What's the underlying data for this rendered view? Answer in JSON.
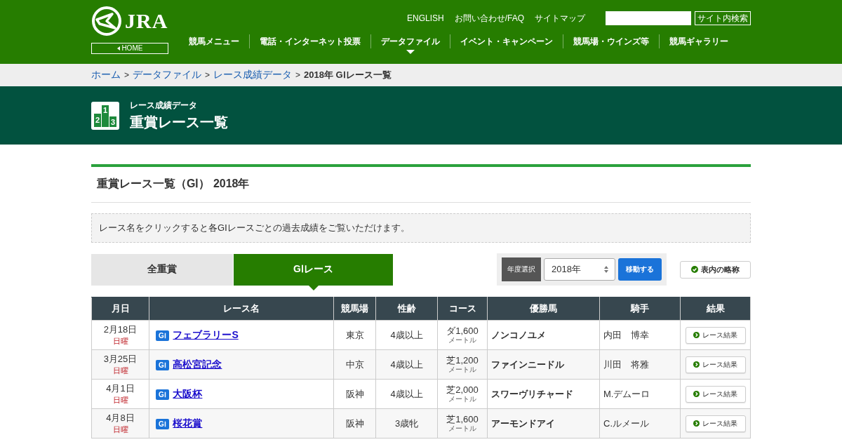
{
  "header": {
    "logo_text": "JRA",
    "home_button": "HOME",
    "top_links": [
      "ENGLISH",
      "お問い合わせ/FAQ",
      "サイトマップ"
    ],
    "search": {
      "button": "サイト内検索"
    },
    "nav": [
      {
        "label": "競馬メニュー",
        "selected": false
      },
      {
        "label": "電話・インターネット投票",
        "selected": false
      },
      {
        "label": "データファイル",
        "selected": true
      },
      {
        "label": "イベント・キャンペーン",
        "selected": false
      },
      {
        "label": "競馬場・ウインズ等",
        "selected": false
      },
      {
        "label": "競馬ギャラリー",
        "selected": false
      }
    ]
  },
  "breadcrumb": {
    "links": [
      {
        "label": "ホーム",
        "separator": ">"
      },
      {
        "label": "データファイル",
        "separator": ">"
      },
      {
        "label": "レース成績データ",
        "separator": ">"
      }
    ],
    "current": "2018年 GⅠレース一覧"
  },
  "page_title": {
    "podium_numbers": [
      "2",
      "1",
      "3"
    ],
    "subtitle": "レース成績データ",
    "title": "重賞レース一覧"
  },
  "section_heading": "重賞レース一覧（GⅠ） 2018年",
  "note": "レース名をクリックすると各GⅠレースごとの過去成績をご覧いただけます。",
  "tabs": [
    {
      "label": "全重賞",
      "selected": false
    },
    {
      "label": "GⅠレース",
      "selected": true
    }
  ],
  "year_select": {
    "label": "年度選択",
    "value": "2018年",
    "button": "移動する"
  },
  "abbrev_button": "表内の略称",
  "table": {
    "columns": [
      "月日",
      "レース名",
      "競馬場",
      "性齢",
      "コース",
      "優勝馬",
      "騎手",
      "結果"
    ],
    "rows": [
      {
        "date": "2月18日",
        "weekday": "日曜",
        "grade": "GⅠ",
        "race": "フェブラリーS",
        "venue": "東京",
        "age": "4歳以上",
        "course": "ダ1,600",
        "unit": "メートル",
        "winner": "ノンコノユメ",
        "jockey": "内田　博幸",
        "result": "レース結果"
      },
      {
        "date": "3月25日",
        "weekday": "日曜",
        "grade": "GⅠ",
        "race": "高松宮記念",
        "venue": "中京",
        "age": "4歳以上",
        "course": "芝1,200",
        "unit": "メートル",
        "winner": "ファインニードル",
        "jockey": "川田　将雅",
        "result": "レース結果"
      },
      {
        "date": "4月1日",
        "weekday": "日曜",
        "grade": "GⅠ",
        "race": "大阪杯",
        "venue": "阪神",
        "age": "4歳以上",
        "course": "芝2,000",
        "unit": "メートル",
        "winner": "スワーヴリチャード",
        "jockey": "M.デムーロ",
        "result": "レース結果"
      },
      {
        "date": "4月8日",
        "weekday": "日曜",
        "grade": "GⅠ",
        "race": "桜花賞",
        "venue": "阪神",
        "age": "3歳牝",
        "course": "芝1,600",
        "unit": "メートル",
        "winner": "アーモンドアイ",
        "jockey": "C.ルメール",
        "result": "レース結果"
      }
    ]
  }
}
